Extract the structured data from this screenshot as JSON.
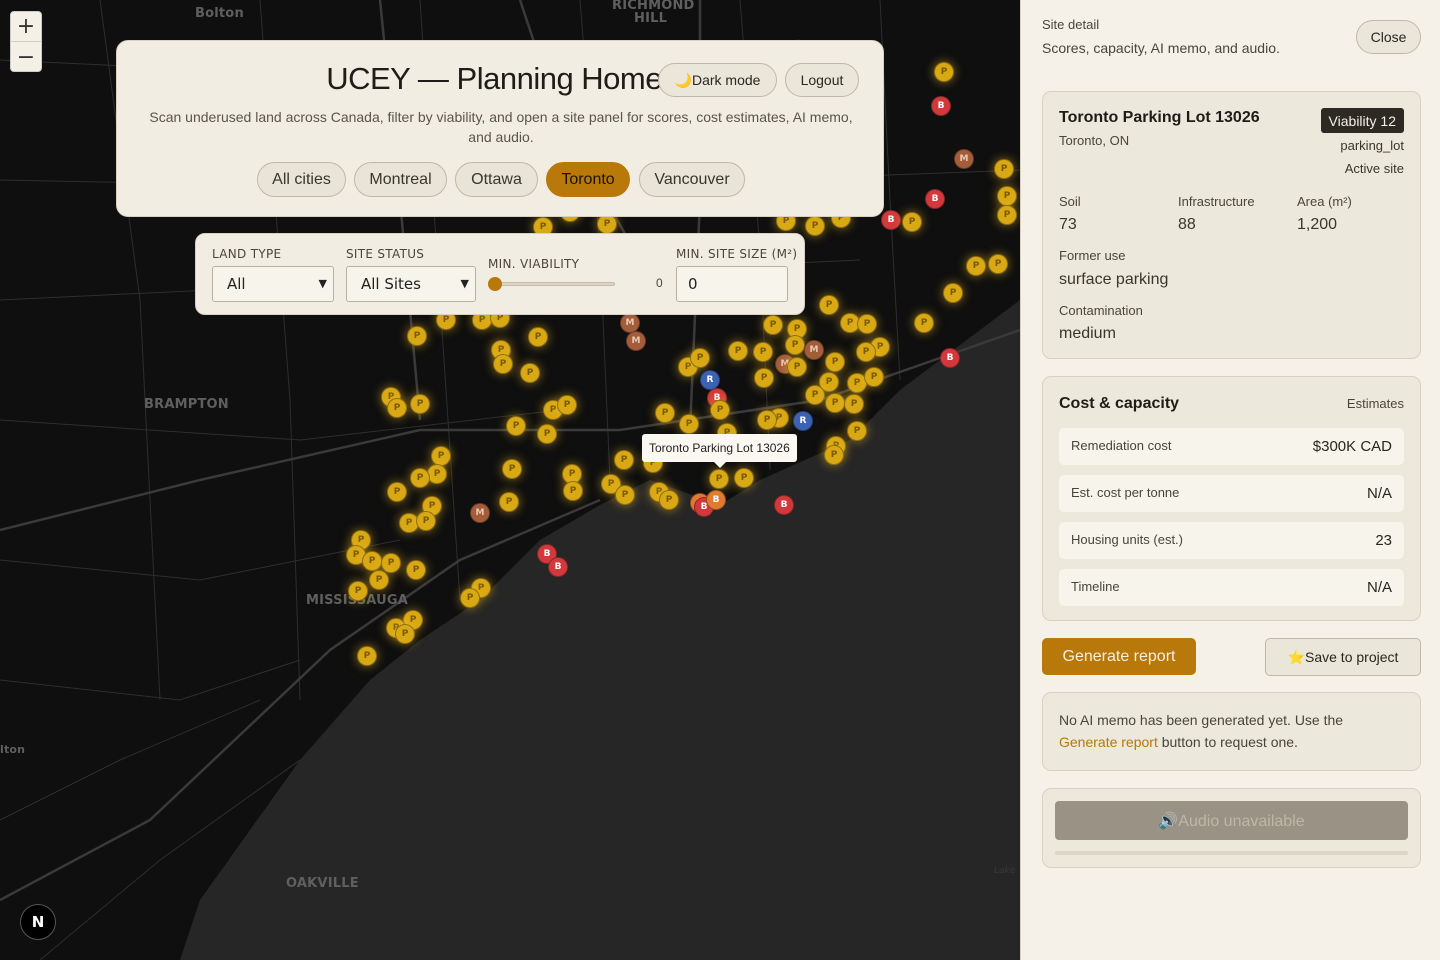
{
  "map": {
    "zoom_in": "+",
    "zoom_out": "−",
    "places": [
      "Bolton",
      "RICHMOND",
      "HILL",
      "BRAMPTON",
      "MISSISSAUGA",
      "OAKVILLE",
      "lton",
      "Lake"
    ],
    "tooltip": "Toronto Parking Lot 13026",
    "badge": "N",
    "marker_letters": {
      "parking": "P",
      "municipal": "M",
      "brownfield": "B",
      "rail": "R"
    }
  },
  "header": {
    "title": "UCEY — Planning Homes",
    "subtitle": "Scan underused land across Canada, filter by viability, and open a site panel for scores, cost estimates, AI memo, and audio.",
    "dark_mode_label": "🌙Dark mode",
    "logout_label": "Logout",
    "cities": [
      "All cities",
      "Montreal",
      "Ottawa",
      "Toronto",
      "Vancouver"
    ],
    "active_city": "Toronto"
  },
  "filters": {
    "land_type_label": "LAND TYPE",
    "land_type_value": "All",
    "site_status_label": "SITE STATUS",
    "site_status_value": "All Sites",
    "min_viability_label": "MIN. VIABILITY",
    "min_viability_value": "0",
    "min_size_label": "MIN. SITE SIZE (M²)",
    "min_size_value": "0"
  },
  "panel": {
    "title": "Site detail",
    "subtitle": "Scores, capacity, AI memo, and audio.",
    "close_label": "Close",
    "site": {
      "name": "Toronto Parking Lot 13026",
      "city": "Toronto, ON",
      "viability": "Viability 12",
      "type": "parking_lot",
      "status": "Active site",
      "soil_label": "Soil",
      "soil": "73",
      "infra_label": "Infrastructure",
      "infra": "88",
      "area_label": "Area (m²)",
      "area": "1,200",
      "former_use_label": "Former use",
      "former_use": "surface parking",
      "contamination_label": "Contamination",
      "contamination": "medium"
    },
    "cost": {
      "title": "Cost & capacity",
      "estimates": "Estimates",
      "rows": [
        {
          "label": "Remediation cost",
          "value": "$300K CAD"
        },
        {
          "label": "Est. cost per tonne",
          "value": "N/A"
        },
        {
          "label": "Housing units (est.)",
          "value": "23"
        },
        {
          "label": "Timeline",
          "value": "N/A"
        }
      ]
    },
    "generate_label": "Generate report",
    "save_label": "⭐Save to project",
    "memo_text_1": "No AI memo has been generated yet. Use the",
    "memo_link": "Generate report",
    "memo_text_2": "button to request one.",
    "audio_label": "🔊Audio unavailable"
  },
  "colors": {
    "accent": "#b8780a",
    "parking": "#d9a915",
    "brownfield": "#d3393c",
    "municipal": "#a35d3b",
    "rail": "#3c62b5"
  }
}
